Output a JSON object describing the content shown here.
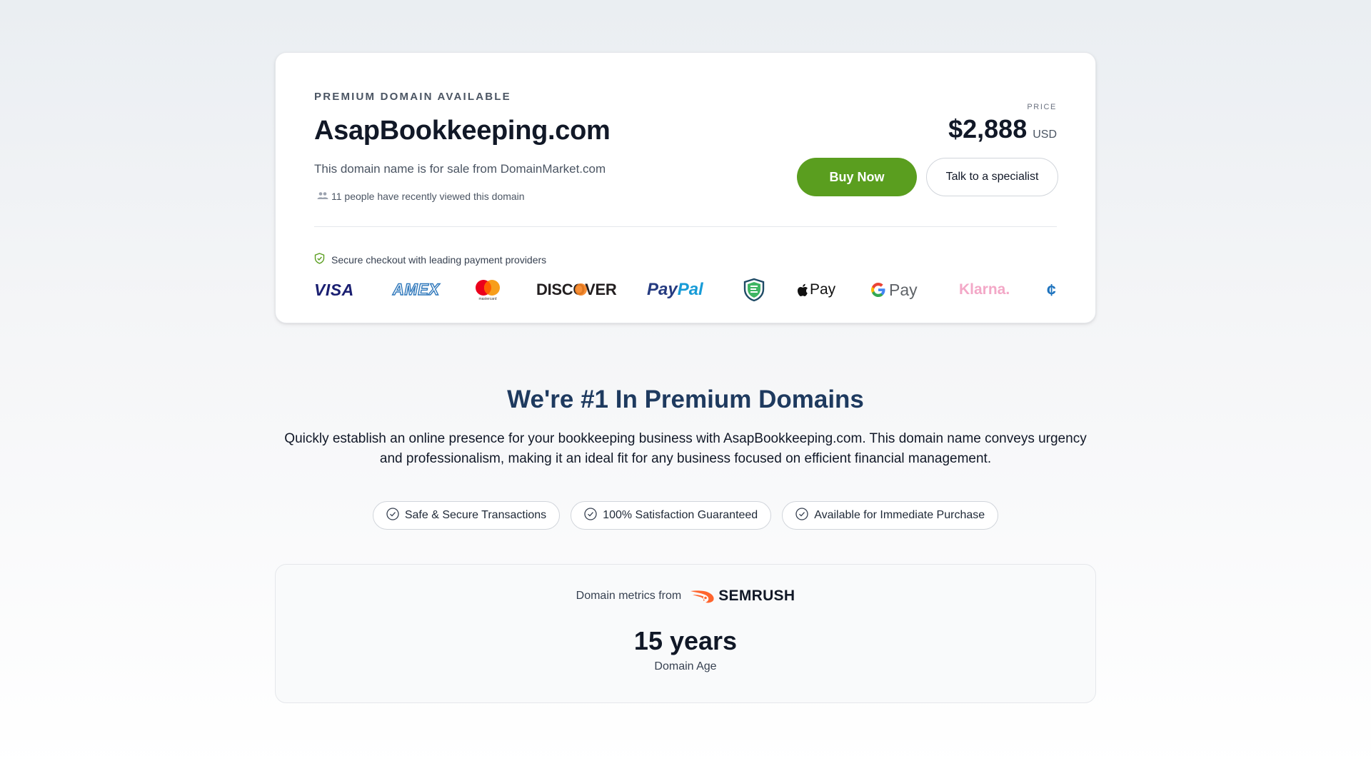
{
  "listing": {
    "eyebrow": "PREMIUM DOMAIN AVAILABLE",
    "domain": "AsapBookkeeping.com",
    "sale_text": "This domain name is for sale from DomainMarket.com",
    "viewers_text": "11 people have recently viewed this domain",
    "price_label": "PRICE",
    "price": "$2,888",
    "currency": "USD",
    "buy_label": "Buy Now",
    "talk_label": "Talk to a specialist",
    "secure_text": "Secure checkout with leading payment providers",
    "payment_methods": [
      "VISA",
      "AMEX",
      "mastercard",
      "DISCOVER",
      "PayPal",
      "escrow-icon",
      "Pay",
      "Pay",
      "Klarna.",
      "coinbase-icon"
    ]
  },
  "hero": {
    "headline": "We're #1 In Premium Domains",
    "description": "Quickly establish an online presence for your bookkeeping business with AsapBookkeeping.com. This domain name conveys urgency and professionalism, making it an ideal fit for any business focused on efficient financial management."
  },
  "badges": [
    {
      "label": "Safe & Secure Transactions",
      "icon": "check-circle-icon"
    },
    {
      "label": "100% Satisfaction Guaranteed",
      "icon": "check-circle-icon"
    },
    {
      "label": "Available for Immediate Purchase",
      "icon": "check-circle-icon"
    }
  ],
  "metrics": {
    "source_label": "Domain metrics from",
    "provider": "SEMRUSH",
    "value": "15 years",
    "label": "Domain Age"
  },
  "colors": {
    "buy_button": "#5a9e1f",
    "headline": "#1e3a5f",
    "semrush_orange": "#ff642d",
    "klarna_pink": "#f3a8c7",
    "paypal_blue": "#253b80",
    "paypal_light": "#179bd7"
  }
}
